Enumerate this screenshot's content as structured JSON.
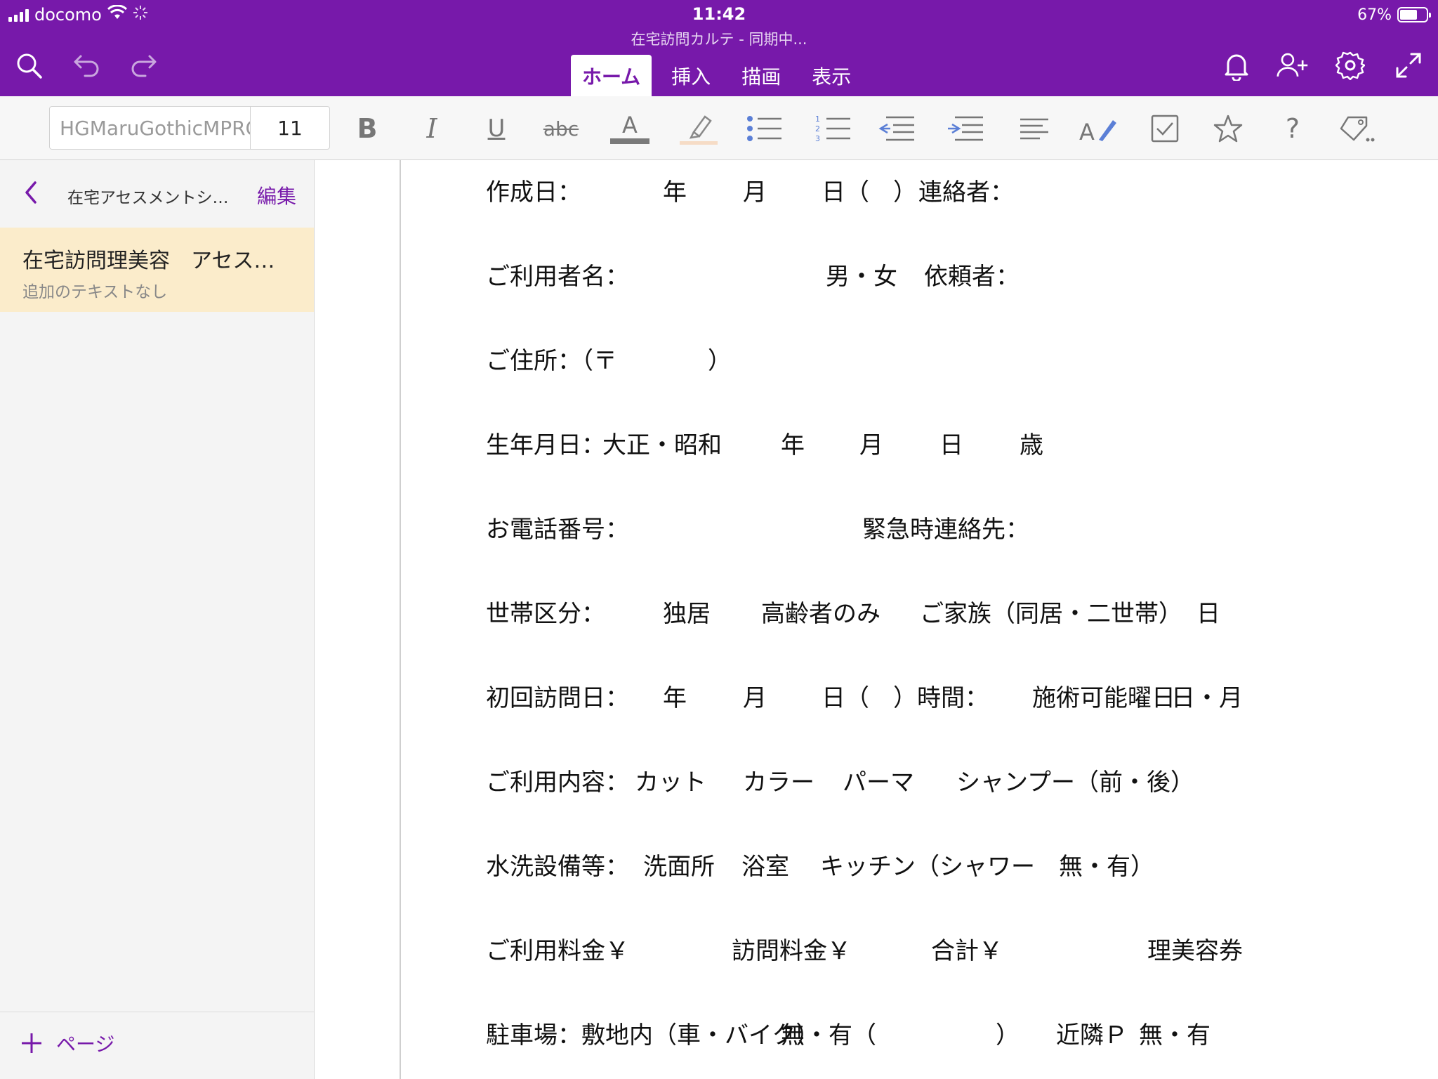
{
  "status_bar": {
    "carrier": "docomo",
    "time": "11:42",
    "battery": "67%",
    "battery_level": 0.67
  },
  "document": {
    "title": "在宅訪問カルテ - 同期中..."
  },
  "ribbon_tabs": [
    {
      "label": "ホーム",
      "active": true
    },
    {
      "label": "挿入",
      "active": false
    },
    {
      "label": "描画",
      "active": false
    },
    {
      "label": "表示",
      "active": false
    }
  ],
  "toolbar": {
    "font_name": "HGMaruGothicMPRO",
    "font_size": "11",
    "bold": "B",
    "italic": "I",
    "underline": "U",
    "strike": "abc",
    "font_color": "A",
    "help": "?"
  },
  "sidebar": {
    "section_name": "在宅アセスメントシ…",
    "edit_label": "編集",
    "pages": [
      {
        "title": "在宅訪問理美容　アセス…",
        "subtitle": "追加のテキストなし"
      }
    ],
    "add_page_label": "ページ"
  },
  "form": {
    "rows": [
      [
        "作成日：",
        "年",
        "月",
        "日（　）",
        "連絡者："
      ],
      [
        "ご利用者名：",
        "男・女",
        "依頼者："
      ],
      [
        "ご住所：（〒",
        "）"
      ],
      [
        "生年月日：",
        "大正・昭和",
        "年",
        "月",
        "日",
        "歳"
      ],
      [
        "お電話番号：",
        "緊急時連絡先："
      ],
      [
        "世帯区分：",
        "独居",
        "高齢者のみ",
        "ご家族（同居・二世帯）",
        "日"
      ],
      [
        "初回訪問日：",
        "年",
        "月",
        "日（　）時間：",
        "施術可能曜日",
        "日・月"
      ],
      [
        "ご利用内容：",
        "カット",
        "カラー",
        "パーマ",
        "シャンプー（前・後）"
      ],
      [
        "水洗設備等：",
        "洗面所",
        "浴室",
        "キッチン（シャワー　無・有）"
      ],
      [
        "ご利用料金￥",
        "訪問料金￥",
        "合計￥",
        "理美容券"
      ],
      [
        "駐車場：敷地内（車・バイク）",
        "無・有（",
        "）",
        "近隣Ｐ",
        "無・有"
      ]
    ]
  },
  "colors": {
    "brand": "#7719aa",
    "selected_page": "#fbeccb"
  }
}
